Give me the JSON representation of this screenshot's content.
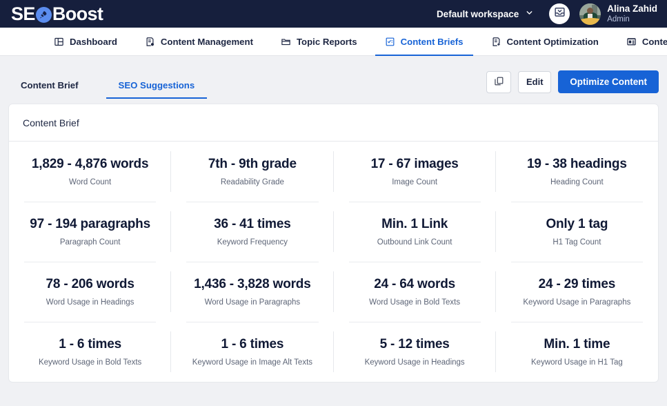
{
  "brand": {
    "text_before": "SE",
    "text_after": "Boost",
    "icon": "rocket-icon",
    "accent": "#5b8def"
  },
  "topbar": {
    "background": "#161f3d",
    "workspace_label": "Default workspace",
    "workspace_chevron": "chevron-down-icon",
    "inbox_icon": "inbox-icon",
    "user_name": "Alina Zahid",
    "user_role": "Admin"
  },
  "nav": {
    "active_index": 3,
    "items": [
      {
        "label": "Dashboard",
        "icon": "layout-panel-icon"
      },
      {
        "label": "Content Management",
        "icon": "document-clock-icon"
      },
      {
        "label": "Topic Reports",
        "icon": "folder-icon"
      },
      {
        "label": "Content Briefs",
        "icon": "document-check-icon"
      },
      {
        "label": "Content Optimization",
        "icon": "document-plus-icon"
      },
      {
        "label": "Content Audits",
        "icon": "document-list-icon"
      }
    ]
  },
  "subtabs": {
    "active_index": 1,
    "items": [
      {
        "label": "Content Brief"
      },
      {
        "label": "SEO Suggestions"
      }
    ]
  },
  "actions": {
    "copy_icon": "copy-icon",
    "edit_label": "Edit",
    "optimize_label": "Optimize Content",
    "primary_color": "#1763d6"
  },
  "card": {
    "title": "Content Brief",
    "stats": [
      {
        "value": "1,829 - 4,876 words",
        "label": "Word Count"
      },
      {
        "value": "7th - 9th grade",
        "label": "Readability Grade"
      },
      {
        "value": "17 - 67 images",
        "label": "Image Count"
      },
      {
        "value": "19 - 38 headings",
        "label": "Heading Count"
      },
      {
        "value": "97 - 194 paragraphs",
        "label": "Paragraph Count"
      },
      {
        "value": "36 - 41 times",
        "label": "Keyword Frequency"
      },
      {
        "value": "Min. 1 Link",
        "label": "Outbound Link Count"
      },
      {
        "value": "Only 1 tag",
        "label": "H1 Tag Count"
      },
      {
        "value": "78 - 206 words",
        "label": "Word Usage in Headings"
      },
      {
        "value": "1,436 - 3,828 words",
        "label": "Word Usage in Paragraphs"
      },
      {
        "value": "24 - 64 words",
        "label": "Word Usage in Bold Texts"
      },
      {
        "value": "24 - 29 times",
        "label": "Keyword Usage in Paragraphs"
      },
      {
        "value": "1 - 6 times",
        "label": "Keyword Usage in Bold Texts"
      },
      {
        "value": "1 - 6 times",
        "label": "Keyword Usage in Image Alt Texts"
      },
      {
        "value": "5 - 12 times",
        "label": "Keyword Usage in Headings"
      },
      {
        "value": "Min. 1 time",
        "label": "Keyword Usage in H1 Tag"
      }
    ]
  }
}
